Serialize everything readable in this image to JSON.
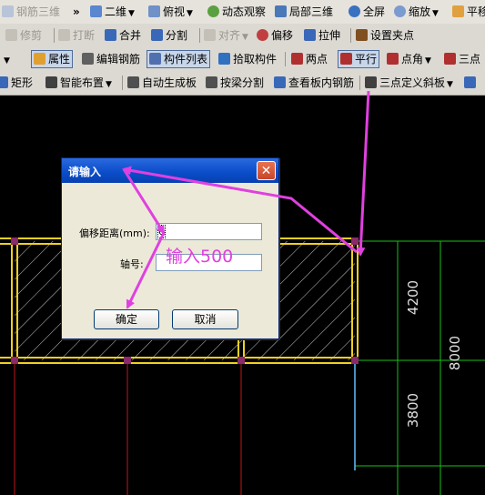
{
  "toolbar1": {
    "items": [
      "钢筋三维",
      "二维",
      "俯视",
      "动态观察",
      "局部三维",
      "全屏",
      "缩放",
      "平移"
    ],
    "overflow": "»"
  },
  "toolbar2": {
    "items": [
      "修剪",
      "打断",
      "合并",
      "分割",
      "对齐",
      "偏移",
      "拉伸",
      "设置夹点"
    ]
  },
  "toolbar3": {
    "items": [
      "属性",
      "编辑钢筋",
      "构件列表",
      "拾取构件",
      "两点",
      "平行",
      "点角",
      "三点"
    ]
  },
  "toolbar4": {
    "items": [
      "矩形",
      "智能布置",
      "自动生成板",
      "按梁分割",
      "查看板内钢筋",
      "三点定义斜板"
    ]
  },
  "dialog": {
    "title": "请输入",
    "close": "✕",
    "offset_label": "偏移距离(mm):",
    "offset_value": "0",
    "axis_label": "轴号:",
    "axis_value": "",
    "ok": "确定",
    "cancel": "取消"
  },
  "annotation": "输入500",
  "drawing": {
    "dims": [
      "4200",
      "8000",
      "3800"
    ]
  },
  "colors": {
    "beam": "#f0d020",
    "grid_green": "#18c018",
    "axis_red": "#c01818",
    "arrow": "#e040e0",
    "title_blue": "#0a4cc8"
  }
}
